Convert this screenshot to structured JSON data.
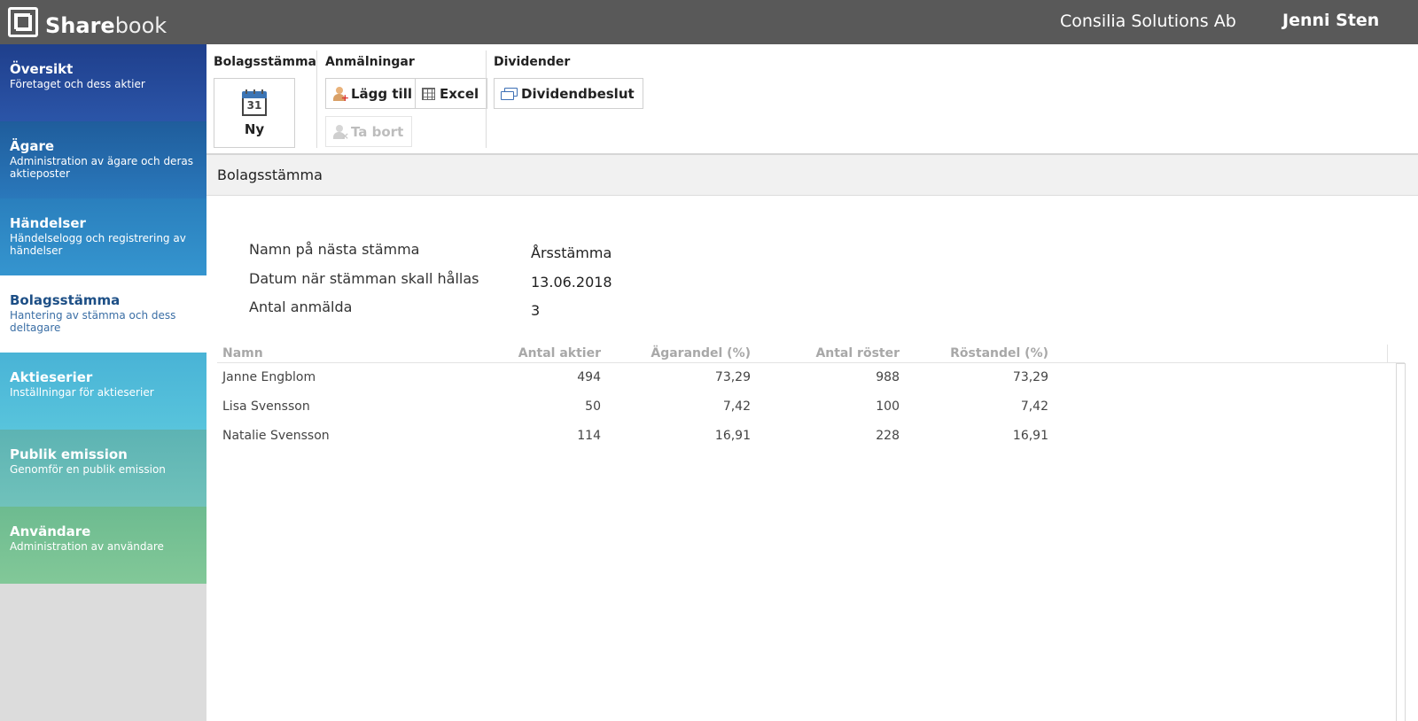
{
  "app": {
    "brand_bold": "Share",
    "brand_light": "book",
    "company": "Consilia Solutions Ab",
    "user": "Jenni Sten"
  },
  "sidebar": {
    "items": [
      {
        "title": "Översikt",
        "subtitle": "Företaget och dess aktier"
      },
      {
        "title": "Ägare",
        "subtitle": "Administration av ägare och deras aktieposter"
      },
      {
        "title": "Händelser",
        "subtitle": "Händelselogg och registrering av händelser"
      },
      {
        "title": "Bolagsstämma",
        "subtitle": "Hantering av stämma och dess deltagare"
      },
      {
        "title": "Aktieserier",
        "subtitle": "Inställningar för aktieserier"
      },
      {
        "title": "Publik emission",
        "subtitle": "Genomför en publik emission"
      },
      {
        "title": "Användare",
        "subtitle": "Administration av användare"
      }
    ],
    "active_index": 3
  },
  "toolbar": {
    "groups": [
      {
        "title": "Bolagsstämma",
        "buttons": [
          {
            "label": "Ny",
            "icon": "calendar-icon",
            "icon_text": "31"
          }
        ]
      },
      {
        "title": "Anmälningar",
        "buttons": [
          {
            "label": "Lägg till",
            "icon": "add-person-icon"
          },
          {
            "label": "Excel",
            "icon": "excel-grid-icon"
          },
          {
            "label": "Ta bort",
            "icon": "remove-person-icon",
            "disabled": true
          }
        ]
      },
      {
        "title": "Dividender",
        "buttons": [
          {
            "label": "Dividendbeslut",
            "icon": "money-icon"
          }
        ]
      }
    ]
  },
  "section": {
    "title": "Bolagsstämma"
  },
  "info": [
    {
      "label": "Namn på nästa stämma",
      "value": "Årsstämma"
    },
    {
      "label": "Datum när stämman skall hållas",
      "value": "13.06.2018"
    },
    {
      "label": "Antal anmälda",
      "value": "3"
    }
  ],
  "table": {
    "columns": [
      "Namn",
      "Antal aktier",
      "Ägarandel (%)",
      "Antal röster",
      "Röstandel (%)"
    ],
    "rows": [
      [
        "Janne Engblom",
        "494",
        "73,29",
        "988",
        "73,29"
      ],
      [
        "Lisa Svensson",
        "50",
        "7,42",
        "100",
        "7,42"
      ],
      [
        "Natalie Svensson",
        "114",
        "16,91",
        "228",
        "16,91"
      ]
    ]
  },
  "colors": {
    "topbar": "#595959",
    "active_nav_text": "#1d4f86",
    "calendar_accent": "#3c75b5"
  }
}
